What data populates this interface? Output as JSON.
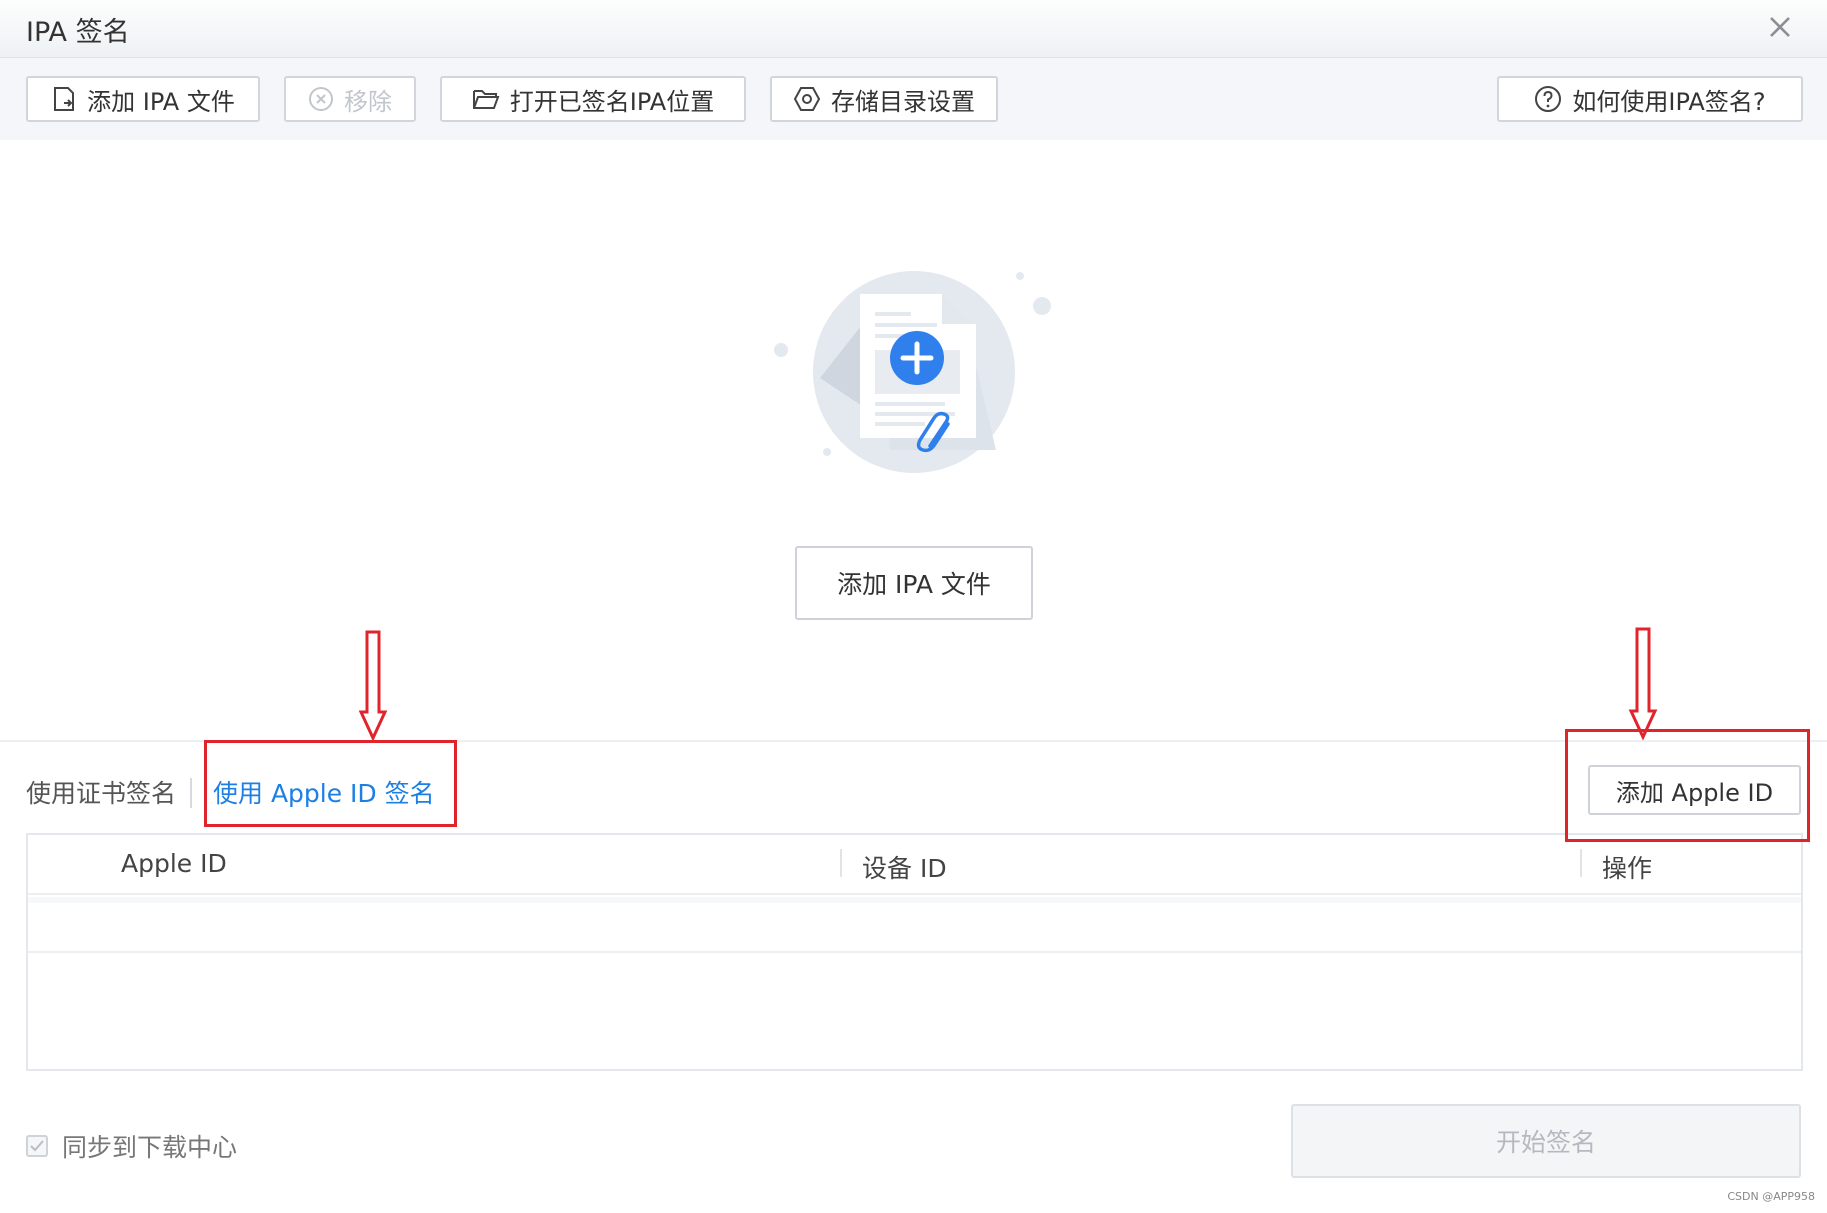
{
  "window": {
    "title": "IPA 签名"
  },
  "toolbar": {
    "add_ipa": "添加 IPA 文件",
    "remove": "移除",
    "open_signed": "打开已签名IPA位置",
    "storage_settings": "存储目录设置",
    "help": "如何使用IPA签名?"
  },
  "main": {
    "add_ipa_button": "添加 IPA 文件"
  },
  "sign_tabs": {
    "cert": "使用证书签名",
    "apple_id": "使用 Apple ID 签名",
    "active": "apple_id"
  },
  "add_apple_id_button": "添加 Apple ID",
  "table": {
    "columns": [
      "Apple ID",
      "设备 ID",
      "操作"
    ],
    "rows": []
  },
  "footer": {
    "sync_label": "同步到下载中心",
    "sync_checked": true,
    "start_button": "开始签名"
  },
  "watermark": "CSDN @APP958",
  "colors": {
    "accent": "#1d7fe4",
    "annotation": "#e0242c",
    "primary_blue": "#2f80ed"
  }
}
